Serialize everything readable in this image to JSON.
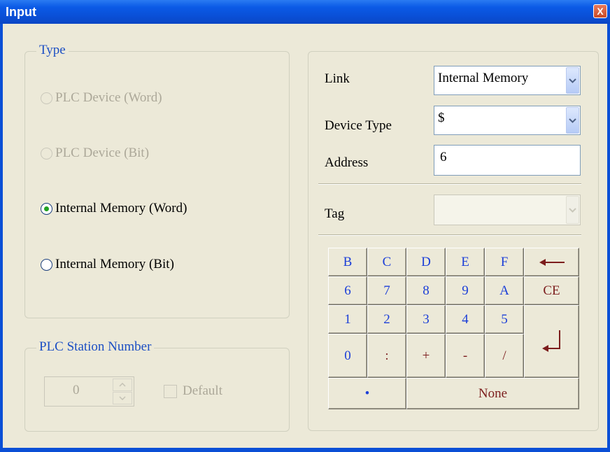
{
  "window": {
    "title": "Input",
    "close_glyph": "X"
  },
  "type_group": {
    "legend": "Type",
    "options": [
      {
        "label": "PLC Device (Word)",
        "enabled": false,
        "selected": false
      },
      {
        "label": "PLC Device (Bit)",
        "enabled": false,
        "selected": false
      },
      {
        "label": "Internal Memory (Word)",
        "enabled": true,
        "selected": true
      },
      {
        "label": "Internal Memory (Bit)",
        "enabled": true,
        "selected": false
      }
    ]
  },
  "station_group": {
    "legend": "PLC Station Number",
    "station_value": "0",
    "default_label": "Default",
    "default_checked": false
  },
  "form": {
    "link_label": "Link",
    "link_value": "Internal Memory",
    "device_type_label": "Device Type",
    "device_type_value": "$",
    "address_label": "Address",
    "address_value": "6",
    "tag_label": "Tag",
    "tag_value": ""
  },
  "keypad": {
    "row1": [
      "B",
      "C",
      "D",
      "E",
      "F"
    ],
    "row2": [
      "6",
      "7",
      "8",
      "9",
      "A"
    ],
    "row3": [
      "1",
      "2",
      "3",
      "4",
      "5"
    ],
    "row4": [
      "0",
      ":",
      "+",
      "-",
      "/"
    ],
    "backspace_icon": "left-arrow-icon",
    "clear_label": "CE",
    "enter_icon": "enter-arrow-icon",
    "dot_label": "•",
    "none_label": "None"
  },
  "colors": {
    "titlebar": "#0a4fd6",
    "legend_blue": "#1c4fc4",
    "key_blue": "#1c3fd8",
    "key_red": "#7c1d1d",
    "radio_dot": "#21a121"
  }
}
